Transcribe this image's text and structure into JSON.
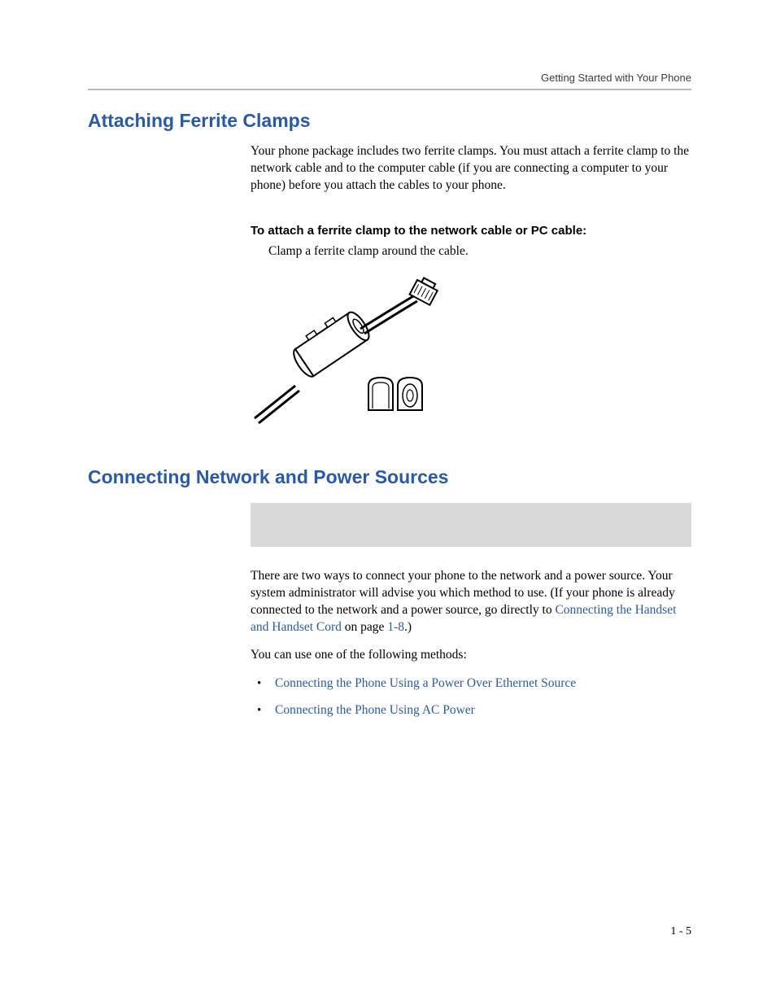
{
  "header": {
    "running_head": "Getting Started with Your Phone"
  },
  "section1": {
    "title": "Attaching Ferrite Clamps",
    "p1": "Your phone package includes two ferrite clamps. You must attach a ferrite clamp to the network cable and to the computer cable (if you are connecting a computer to your phone) before you attach the cables to your phone.",
    "sub_heading": "To attach a ferrite clamp to the network cable or PC cable:",
    "step": "Clamp a ferrite clamp around the cable."
  },
  "section2": {
    "title": "Connecting Network and Power Sources",
    "p1_pre": "There are two ways to connect your phone to the network and a power source. Your system administrator will advise you which method to use. (If your phone is already connected to the network and a power source, go directly to ",
    "p1_link": "Connecting the Handset and Handset Cord",
    "p1_mid": " on page ",
    "p1_page_ref": "1-8",
    "p1_post": ".)",
    "p2": "You can use one of the following methods:",
    "bullets": [
      "Connecting the Phone Using a Power Over Ethernet Source",
      "Connecting the Phone Using AC Power"
    ]
  },
  "footer": {
    "page_number": "1 - 5"
  }
}
